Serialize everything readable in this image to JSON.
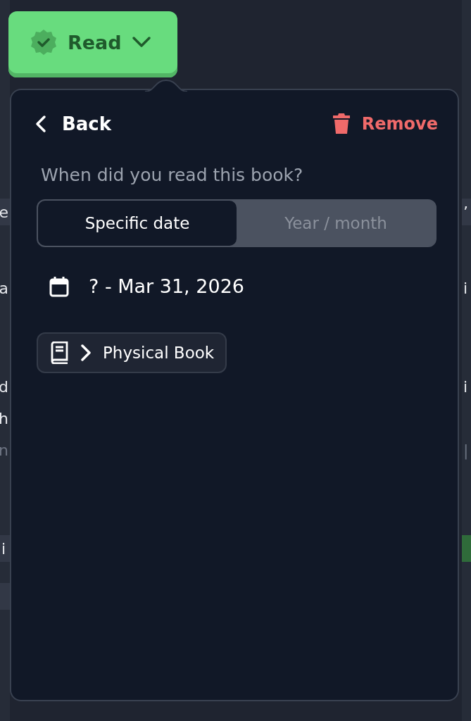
{
  "status_button": {
    "label": "Read",
    "checked": true
  },
  "popover": {
    "back": "Back",
    "remove": "Remove",
    "question": "When did you read this book?",
    "modes": [
      {
        "label": "Specific date",
        "selected": true
      },
      {
        "label": "Year / month",
        "selected": false
      }
    ],
    "date_range": "? - Mar 31, 2026",
    "format": "Physical Book"
  },
  "background_left": [
    {
      "text": "e",
      "kind": "pill"
    },
    {
      "text": "a",
      "kind": "text"
    },
    {
      "text": "d",
      "kind": "text"
    },
    {
      "text": "h",
      "kind": "text"
    },
    {
      "text": "n",
      "kind": "dim"
    },
    {
      "text": "i",
      "kind": "tag"
    },
    {
      "kind": "tag"
    }
  ],
  "background_right": [
    {
      "text": "’",
      "kind": "pill"
    },
    {
      "text": "i",
      "kind": "text"
    },
    {
      "text": "i",
      "kind": "text"
    },
    {
      "kind": "blank"
    },
    {
      "text": "|",
      "kind": "dim"
    },
    {
      "kind": "blank"
    },
    {
      "kind": "greentag"
    }
  ]
}
